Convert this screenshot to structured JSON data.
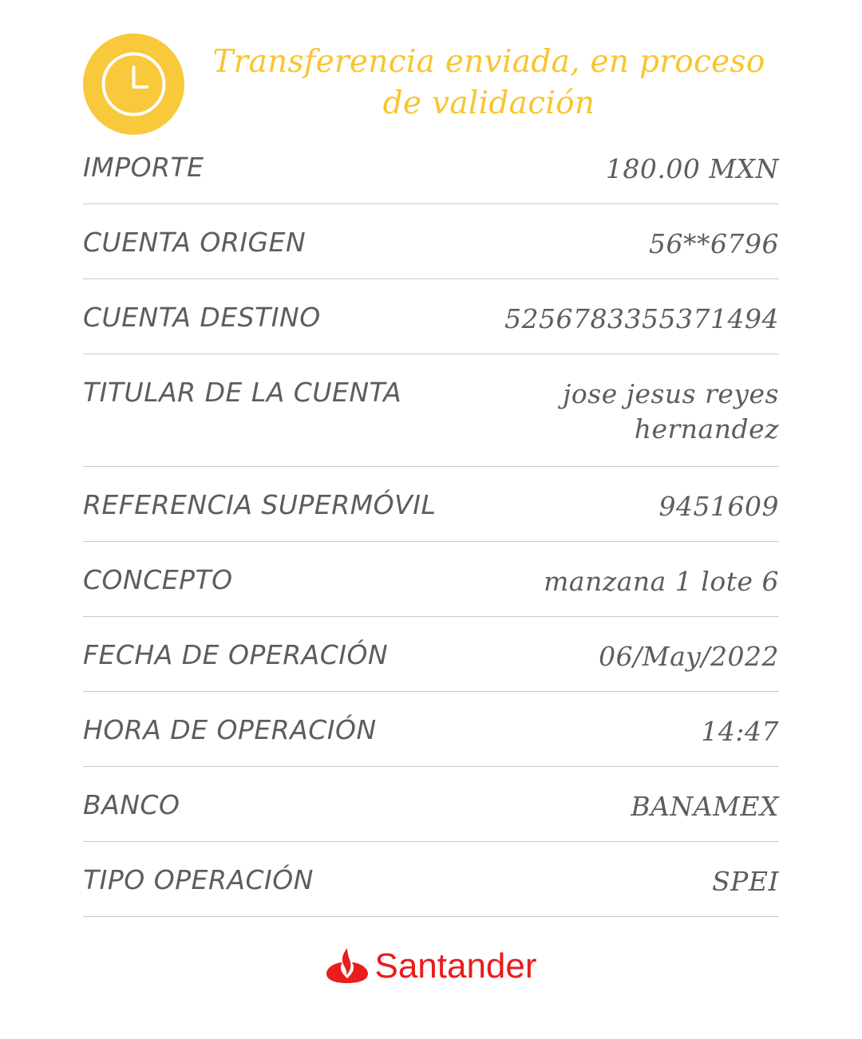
{
  "header": {
    "status_icon": "clock-icon",
    "title": "Transferencia enviada, en proceso de validación",
    "accent_color": "#f8c93a"
  },
  "rows": [
    {
      "label": "IMPORTE",
      "value": "180.00 MXN"
    },
    {
      "label": "CUENTA ORIGEN",
      "value": "56**6796"
    },
    {
      "label": "CUENTA DESTINO",
      "value": "5256783355371494"
    },
    {
      "label": "TITULAR DE LA CUENTA",
      "value": "jose jesus reyes hernandez"
    },
    {
      "label": "REFERENCIA SUPERMÓVIL",
      "value": "9451609"
    },
    {
      "label": "CONCEPTO",
      "value": "manzana 1 lote 6"
    },
    {
      "label": "FECHA DE OPERACIÓN",
      "value": "06/May/2022"
    },
    {
      "label": "HORA DE OPERACIÓN",
      "value": "14:47"
    },
    {
      "label": "BANCO",
      "value": "BANAMEX"
    },
    {
      "label": "TIPO OPERACIÓN",
      "value": "SPEI"
    }
  ],
  "footer": {
    "brand": "Santander",
    "brand_icon": "santander-flame-icon",
    "brand_color": "#ea1c1c"
  }
}
